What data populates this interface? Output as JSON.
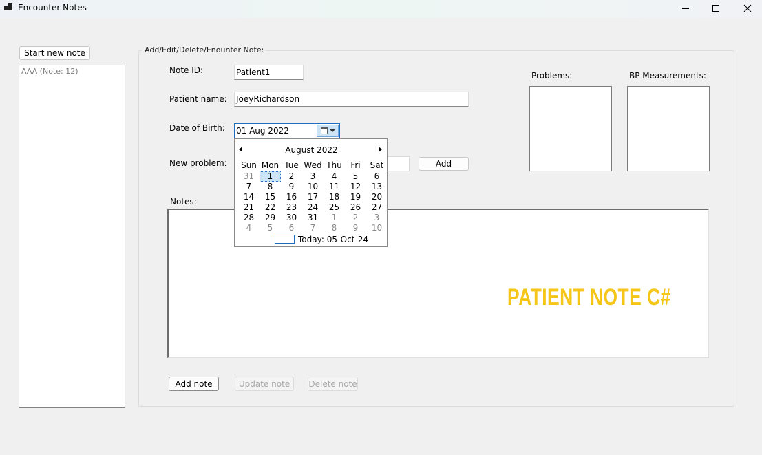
{
  "window": {
    "title": "Encounter Notes"
  },
  "sidebar": {
    "start_button": "Start new note",
    "items": [
      "AAA (Note: 12)"
    ]
  },
  "form": {
    "group_title": "Add/Edit/Delete/Enounter Note:",
    "note_id_label": "Note ID:",
    "note_id_value": "Patient1",
    "patient_name_label": "Patient name:",
    "patient_name_value": "JoeyRichardson",
    "dob_label": "Date of Birth:",
    "dob_value": "01 Aug 2022",
    "new_problem_label": "New problem:",
    "new_problem_value": "",
    "add_button": "Add",
    "problems_label": "Problems:",
    "bp_label": "BP Measurements:",
    "notes_label": "Notes:",
    "add_note_button": "Add note",
    "update_note_button": "Update note",
    "delete_note_button": "Delete note"
  },
  "watermark": "PATIENT NOTE C#",
  "calendar": {
    "title": "August 2022",
    "weekdays": [
      "Sun",
      "Mon",
      "Tue",
      "Wed",
      "Thu",
      "Fri",
      "Sat"
    ],
    "weeks": [
      [
        "31",
        "1",
        "2",
        "3",
        "4",
        "5",
        "6"
      ],
      [
        "7",
        "8",
        "9",
        "10",
        "11",
        "12",
        "13"
      ],
      [
        "14",
        "15",
        "16",
        "17",
        "18",
        "19",
        "20"
      ],
      [
        "21",
        "22",
        "23",
        "24",
        "25",
        "26",
        "27"
      ],
      [
        "28",
        "29",
        "30",
        "31",
        "1",
        "2",
        "3"
      ],
      [
        "4",
        "5",
        "6",
        "7",
        "8",
        "9",
        "10"
      ]
    ],
    "selected_day": "1",
    "today": "Today: 05-Oct-24"
  }
}
